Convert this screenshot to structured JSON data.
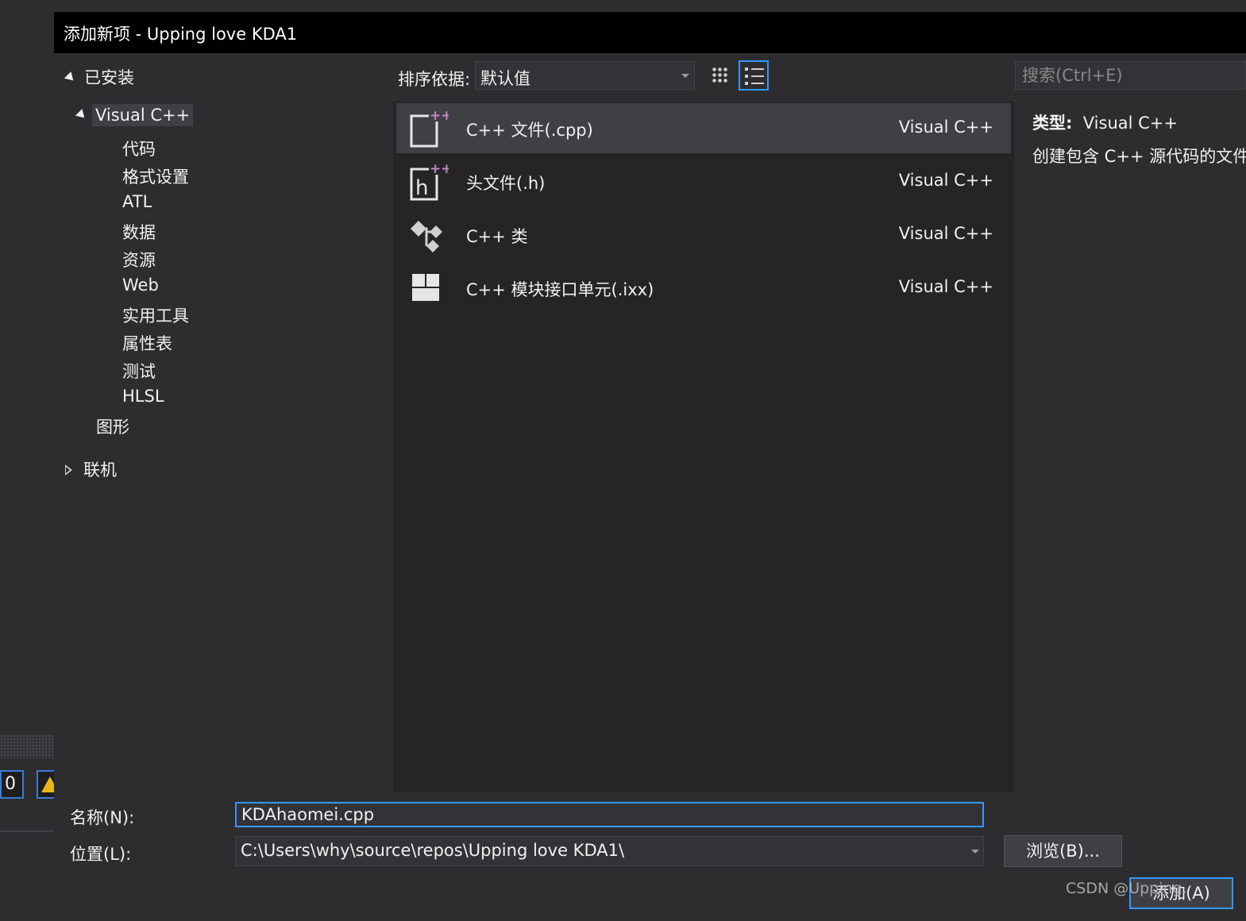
{
  "dialog": {
    "title": "添加新项 - Upping love KDA1"
  },
  "tree": {
    "installed": "已安装",
    "visual_cpp": "Visual C++",
    "children": [
      "代码",
      "格式设置",
      "ATL",
      "数据",
      "资源",
      "Web",
      "实用工具",
      "属性表",
      "测试",
      "HLSL"
    ],
    "graphics": "图形",
    "online": "联机"
  },
  "toolbar": {
    "sort_label": "排序依据:",
    "sort_value": "默认值",
    "search_placeholder": "搜索(Ctrl+E)"
  },
  "templates": [
    {
      "name": "C++ 文件(.cpp)",
      "lang": "Visual C++",
      "icon": "cpp-file-icon"
    },
    {
      "name": "头文件(.h)",
      "lang": "Visual C++",
      "icon": "header-file-icon"
    },
    {
      "name": "C++ 类",
      "lang": "Visual C++",
      "icon": "cpp-class-icon"
    },
    {
      "name": "C++ 模块接口单元(.ixx)",
      "lang": "Visual C++",
      "icon": "module-interface-icon"
    }
  ],
  "info": {
    "type_label": "类型:",
    "type_value": "Visual C++",
    "description": "创建包含 C++ 源代码的文件"
  },
  "form": {
    "name_label": "名称(N):",
    "name_value": "KDAhaomei.cpp",
    "location_label": "位置(L):",
    "location_value": "C:\\Users\\why\\source\\repos\\Upping love KDA1\\",
    "browse_label": "浏览(B)...",
    "add_label": "添加(A)"
  },
  "background": {
    "error_count": "0"
  },
  "watermark": "CSDN @Upping.",
  "colors": {
    "accent": "#3399ff",
    "dialog_bg": "#2d2d30",
    "list_bg": "#252526",
    "selected": "#3f3f46",
    "titlebar": "#000000",
    "plus_badge": "#c586c0"
  }
}
